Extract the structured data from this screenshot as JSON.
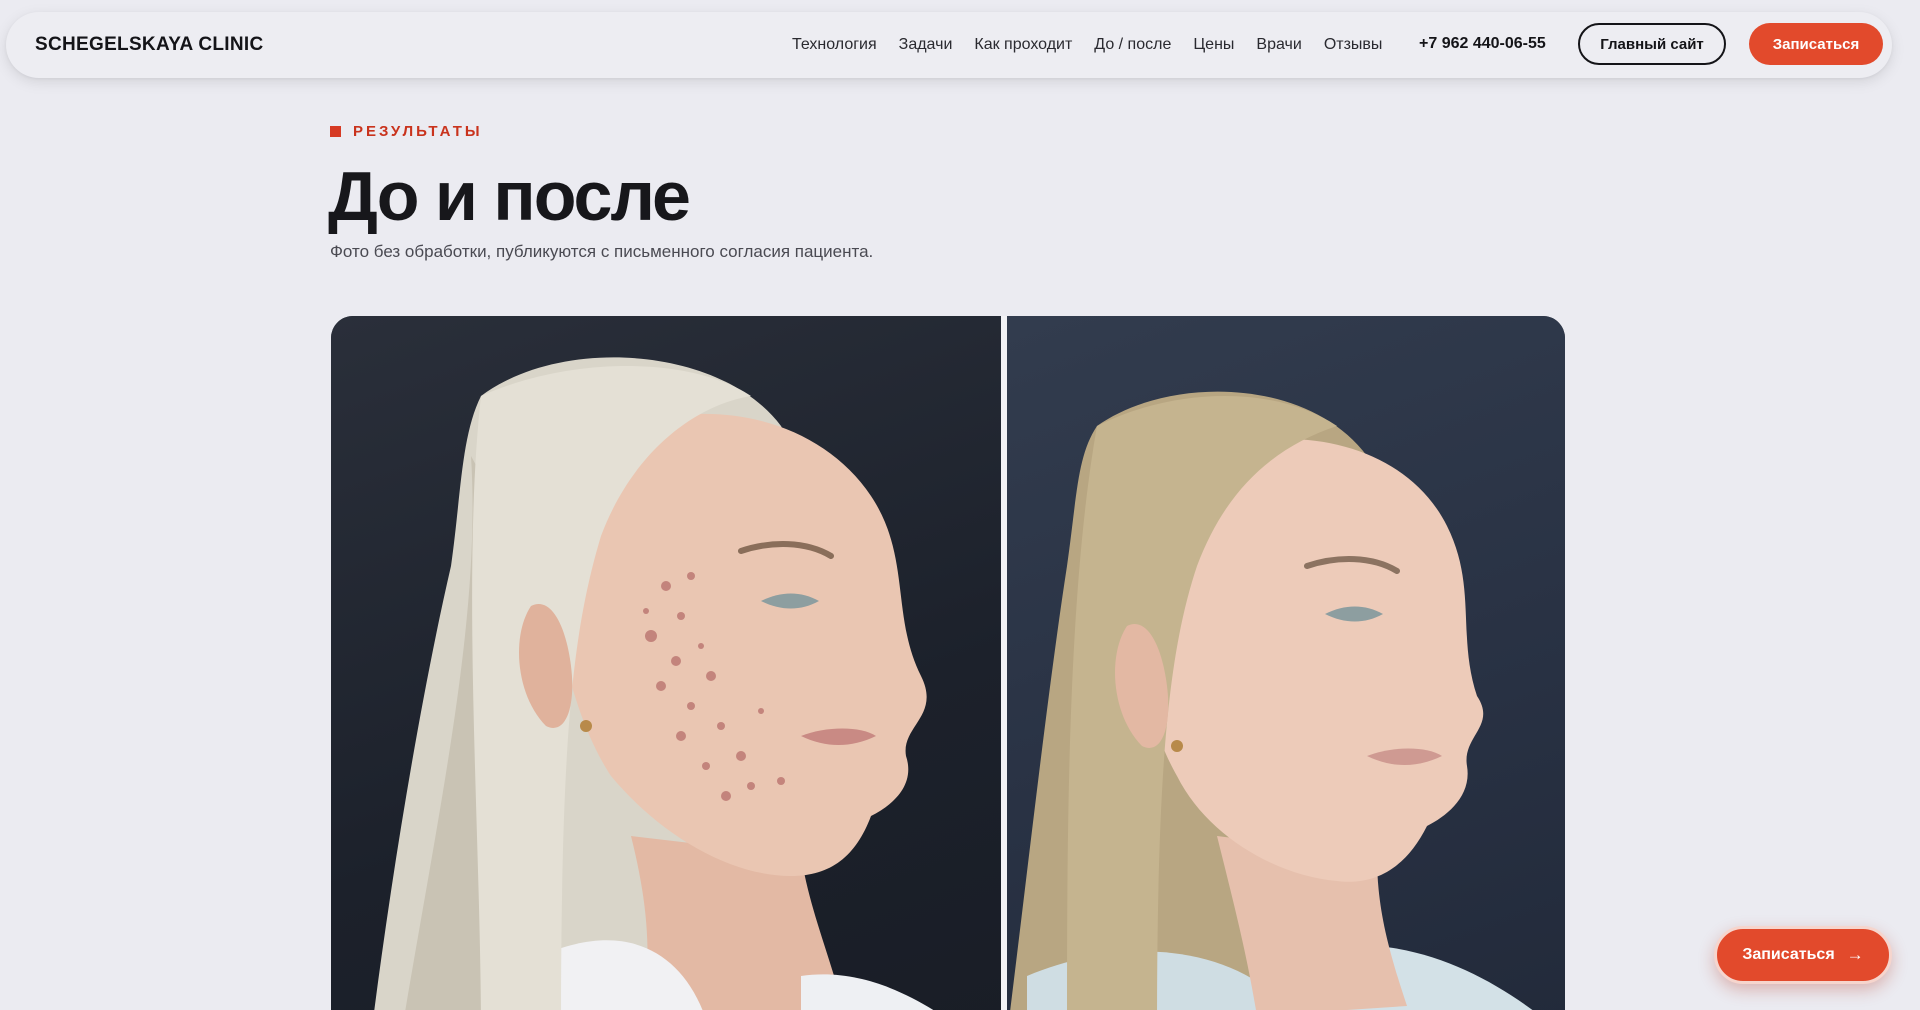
{
  "header": {
    "logo": "SCHEGELSKAYA CLINIC",
    "nav": [
      "Технология",
      "Задачи",
      "Как проходит",
      "До / после",
      "Цены",
      "Врачи",
      "Отзывы"
    ],
    "phone": "+7 962 440-06-55",
    "main_site_label": "Главный сайт",
    "signup_label": "Записаться"
  },
  "section": {
    "eyebrow": "РЕЗУЛЬТАТЫ",
    "title": "До и после",
    "subtitle": "Фото без обработки, публикуются с письменного согласия пациента."
  },
  "floating_cta": {
    "label": "Записаться",
    "icon": "arrow-right-icon"
  },
  "colors": {
    "accent": "#e24a2c",
    "background": "#ebebf1",
    "text": "#17171b"
  }
}
